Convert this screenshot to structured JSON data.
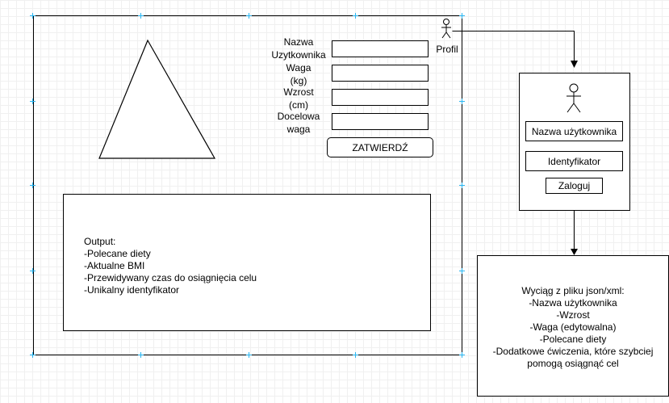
{
  "form": {
    "username_label_1": "Nazwa",
    "username_label_2": "Uzytkownika",
    "weight_label_1": "Waga",
    "weight_label_2": "(kg)",
    "height_label_1": "Wzrost",
    "height_label_2": "(cm)",
    "target_label_1": "Docelowa",
    "target_label_2": "waga",
    "submit_label": "ZATWIERDŹ"
  },
  "output": {
    "lines": [
      "Output:",
      "-Polecane diety",
      "-Aktualne BMI",
      "-Przewidywany czas do osiągnięcia celu",
      "-Unikalny identyfikator"
    ]
  },
  "profile": {
    "label": "Profil"
  },
  "login_panel": {
    "username": "Nazwa użytkownika",
    "identifier": "Identyfikator",
    "login_button": "Zaloguj"
  },
  "extract": {
    "lines": [
      "Wyciąg z pliku json/xml:",
      "-Nazwa użytkownika",
      "-Wzrost",
      "-Waga (edytowalna)",
      "-Polecane diety",
      "-Dodatkowe ćwiczenia, które szybciej",
      "pomogą osiągnąć cel"
    ]
  },
  "colors": {
    "selection_handle": "#29b6f2",
    "stroke": "#000000"
  },
  "icons": [
    "triangle-shape",
    "person-icon",
    "arrow-head-icon"
  ]
}
